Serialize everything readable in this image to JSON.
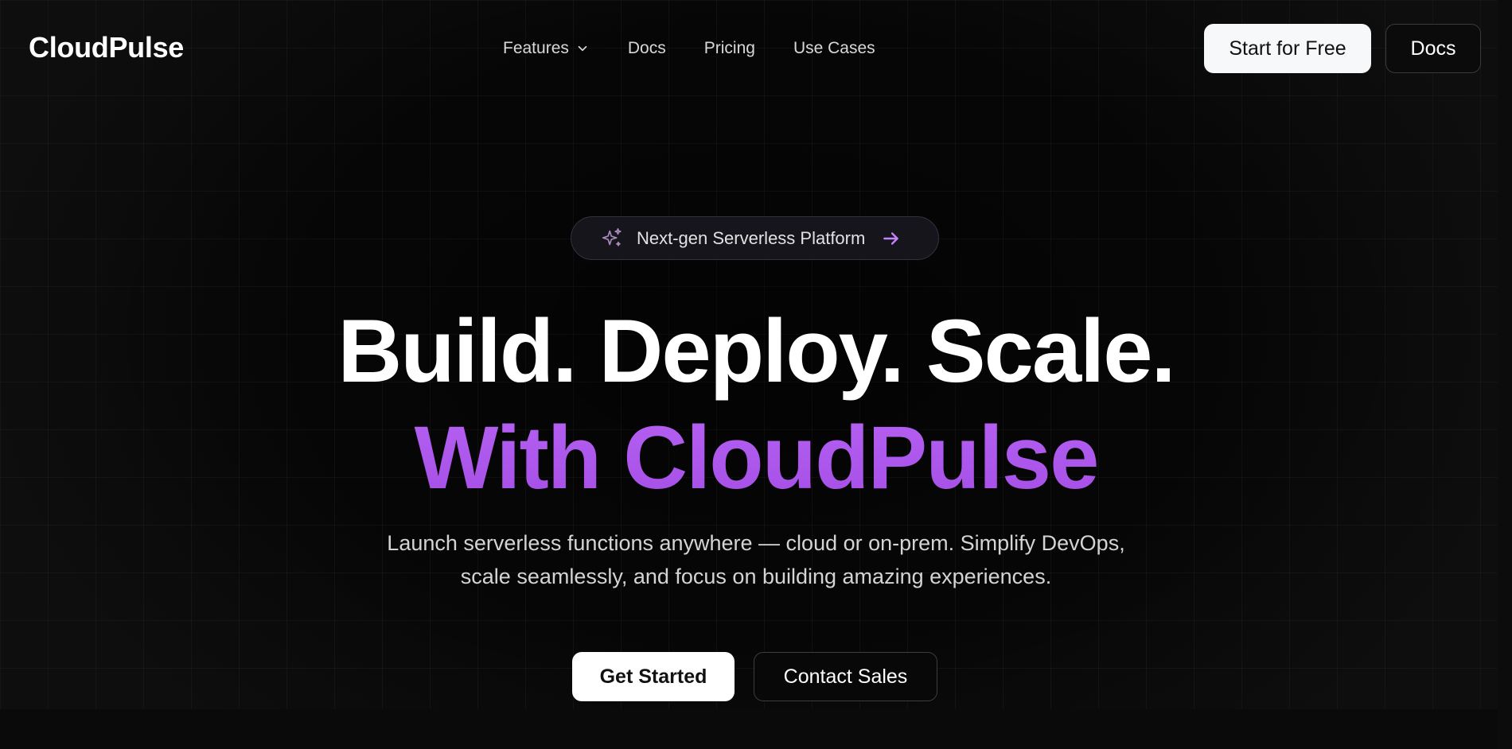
{
  "brand": {
    "name": "CloudPulse"
  },
  "nav": {
    "items": [
      {
        "label": "Features",
        "has_dropdown": true,
        "icon": "chevron-down-icon"
      },
      {
        "label": "Docs"
      },
      {
        "label": "Pricing"
      },
      {
        "label": "Use Cases"
      }
    ],
    "cta_primary": "Start for Free",
    "cta_secondary": "Docs"
  },
  "badge": {
    "icon": "sparkle-icon",
    "text": "Next-gen Serverless Platform",
    "arrow_icon": "arrow-right-icon",
    "accent_color": "#c084fc"
  },
  "hero": {
    "title_line1": "Build. Deploy. Scale.",
    "title_line2": "With CloudPulse",
    "title_accent_color": "#b05cf0",
    "subtitle_line1": "Launch serverless functions anywhere — cloud or on-prem. Simplify DevOps,",
    "subtitle_line2": "scale seamlessly, and focus on building amazing experiences.",
    "primary_button": "Get Started",
    "secondary_button": "Contact Sales"
  },
  "colors": {
    "background": "#070707",
    "primary_button_bg": "#ffffff",
    "nav_cta_bg": "#f7f8fa"
  }
}
